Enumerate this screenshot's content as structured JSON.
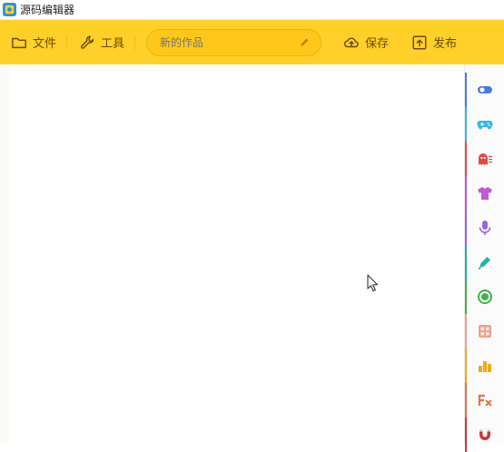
{
  "window": {
    "title": "源码编辑器"
  },
  "toolbar": {
    "file_label": "文件",
    "tools_label": "工具",
    "project_name_value": "",
    "project_name_placeholder": "新的作品",
    "save_label": "保存",
    "publish_label": "发布"
  },
  "colors": {
    "toolbar_bg": "#ffd02a",
    "toolbar_text": "#6a4b00"
  },
  "categories": [
    {
      "icon": "toggle-icon",
      "color": "#4a7bd8"
    },
    {
      "icon": "gamepad-icon",
      "color": "#38b6e8"
    },
    {
      "icon": "ghost-icon",
      "color": "#e04848"
    },
    {
      "icon": "shirt-icon",
      "color": "#c05ad6"
    },
    {
      "icon": "microphone-icon",
      "color": "#9a63e0"
    },
    {
      "icon": "pen-icon",
      "color": "#24b3a3"
    },
    {
      "icon": "circle-icon",
      "color": "#3fb24c"
    },
    {
      "icon": "calculator-icon",
      "color": "#e9a38e"
    },
    {
      "icon": "bar-chart-icon",
      "color": "#f2a81d"
    },
    {
      "icon": "function-icon",
      "color": "#d9784a"
    },
    {
      "icon": "magnet-icon",
      "color": "#c63a3a"
    }
  ]
}
